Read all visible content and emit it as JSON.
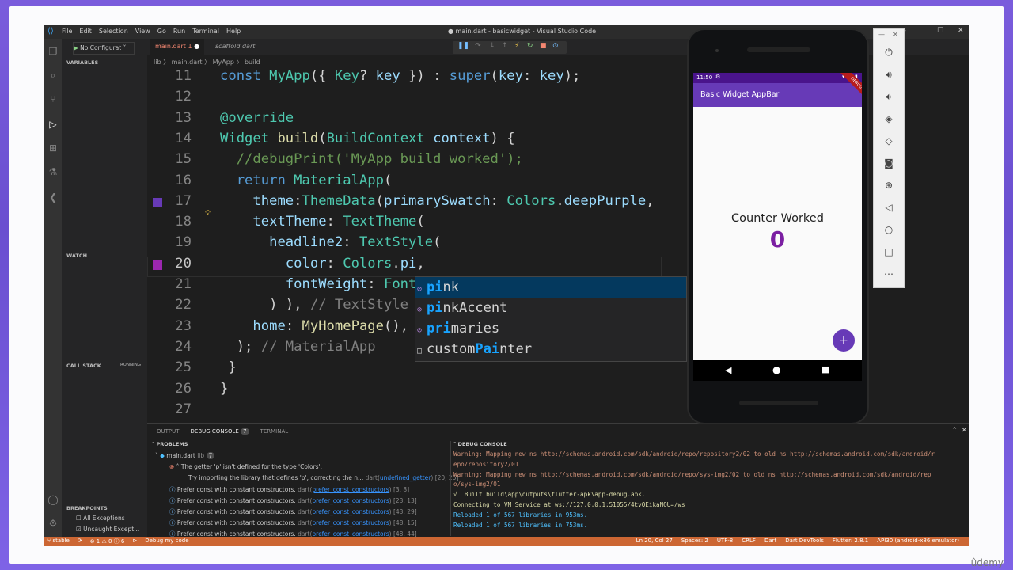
{
  "window": {
    "title": "● main.dart - basicwidget - Visual Studio Code",
    "menu": [
      "File",
      "Edit",
      "Selection",
      "View",
      "Go",
      "Run",
      "Terminal",
      "Help"
    ]
  },
  "debug": {
    "config_label": "No Configurat",
    "badge": "1"
  },
  "sidebar": {
    "variables": "VARIABLES",
    "watch": "WATCH",
    "call_stack": "CALL STACK",
    "call_stack_status": "RUNNING",
    "breakpoints": "BREAKPOINTS",
    "bp_all": "All Exceptions",
    "bp_uncaught": "Uncaught Except..."
  },
  "tabs": [
    {
      "label": "main.dart 1",
      "active": true,
      "modified": true
    },
    {
      "label": "scaffold.dart",
      "active": false
    }
  ],
  "breadcrumb": "lib 〉 main.dart 〉 MyApp 〉 build",
  "code_lines": [
    {
      "n": "11",
      "html": "<span class='kw'>const</span> <span class='ty'>MyApp</span><span class='pu'>({ </span><span class='ty'>Key</span><span class='pu'>? </span><span class='va'>key</span><span class='pu'> }) : </span><span class='kw'>super</span><span class='pu'>(</span><span class='va'>key</span><span class='pu'>: </span><span class='va'>key</span><span class='pu'>);</span>"
    },
    {
      "n": "12",
      "html": ""
    },
    {
      "n": "13",
      "html": "<span class='an'>@override</span>"
    },
    {
      "n": "14",
      "html": "<span class='ty'>Widget</span> <span class='fn'>build</span><span class='pu'>(</span><span class='ty'>BuildContext</span> <span class='va'>context</span><span class='pu'>) {</span>"
    },
    {
      "n": "15",
      "html": "  <span class='cm'>//debugPrint('MyApp build worked');</span>"
    },
    {
      "n": "16",
      "html": "  <span class='kw'>return</span> <span class='ty'>MaterialApp</span><span class='pu'>(</span>"
    },
    {
      "n": "17",
      "html": "    <span class='va'>theme</span><span class='pu'>:</span><span class='ty'>ThemeData</span><span class='pu'>(</span><span class='va'>primarySwatch</span><span class='pu'>: </span><span class='ty'>Colors</span><span class='pu'>.</span><span class='va'>deepPurple</span><span class='pu'>,</span>"
    },
    {
      "n": "18",
      "html": "    <span class='va'>textTheme</span><span class='pu'>: </span><span class='ty'>TextTheme</span><span class='pu'>(</span>"
    },
    {
      "n": "19",
      "html": "      <span class='va'>headline2</span><span class='pu'>: </span><span class='ty'>TextStyle</span><span class='pu'>(</span>"
    },
    {
      "n": "20",
      "html": "        <span class='va'>color</span><span class='pu'>: </span><span class='ty'>Colors</span><span class='pu'>.</span><span class='va'>pi</span><span class='pu'>,</span>"
    },
    {
      "n": "21",
      "html": "        <span class='va'>fontWeight</span><span class='pu'>: </span><span class='ty'>Font</span>"
    },
    {
      "n": "22",
      "html": "      <span class='pu'>) )</span><span class='pu'>, </span><span class='cm' style='color:#808080'>// TextStyle</span>"
    },
    {
      "n": "23",
      "html": "    <span class='va'>home</span><span class='pu'>: </span><span class='fn'>MyHomePage</span><span class='pu'>(), </span>"
    },
    {
      "n": "24",
      "html": "  <span class='pu'>); </span><span style='color:#808080'>// MaterialApp</span>"
    },
    {
      "n": "25",
      "html": " <span class='pu'>}</span>"
    },
    {
      "n": "26",
      "html": "<span class='pu'>}</span>"
    },
    {
      "n": "27",
      "html": ""
    }
  ],
  "suggestions": [
    {
      "label": "pink",
      "match": "pi",
      "rest": "nk"
    },
    {
      "label": "pinkAccent",
      "match": "pi",
      "rest": "nkAccent"
    },
    {
      "label": "primaries",
      "match": "pri",
      "rest": "maries"
    },
    {
      "label": "customPainter",
      "pre": "custom",
      "match": "Pai",
      "rest": "nter"
    }
  ],
  "panel": {
    "tabs": [
      "OUTPUT",
      "DEBUG CONSOLE",
      "TERMINAL"
    ],
    "debug_count": "7",
    "problems_header": "PROBLEMS",
    "problems_file": "main.dart",
    "problems_file_dir": "lib",
    "problems_count": "7",
    "debug_console_header": "DEBUG CONSOLE",
    "problems": [
      {
        "kind": "error",
        "text": "The getter 'p' isn't defined for the type 'Colors'.",
        "source": "",
        "loc": ""
      },
      {
        "kind": "hint",
        "text": "Try importing the library that defines 'p', correcting the n...",
        "source": "dart(undefined_getter)",
        "loc": "[20, 25]"
      },
      {
        "kind": "info",
        "text": "Prefer const with constant constructors.",
        "source": "dart(prefer_const_constructors)",
        "loc": "[3, 8]"
      },
      {
        "kind": "info",
        "text": "Prefer const with constant constructors.",
        "source": "dart(prefer_const_constructors)",
        "loc": "[23, 13]"
      },
      {
        "kind": "info",
        "text": "Prefer const with constant constructors.",
        "source": "dart(prefer_const_constructors)",
        "loc": "[43, 29]"
      },
      {
        "kind": "info",
        "text": "Prefer const with constant constructors.",
        "source": "dart(prefer_const_constructors)",
        "loc": "[48, 15]"
      },
      {
        "kind": "info",
        "text": "Prefer const with constant constructors.",
        "source": "dart(prefer_const_constructors)",
        "loc": "[48, 44]"
      }
    ],
    "console_lines": [
      {
        "color": "#ce9178",
        "text": "Warning: Mapping new ns http://schemas.android.com/sdk/android/repo/repository2/02 to old ns http://schemas.android.com/sdk/android/r"
      },
      {
        "color": "#ce9178",
        "text": "epo/repository2/01"
      },
      {
        "color": "#ce9178",
        "text": "Warning: Mapping new ns http://schemas.android.com/sdk/android/repo/sys-img2/02 to old ns http://schemas.android.com/sdk/android/rep"
      },
      {
        "color": "#ce9178",
        "text": "o/sys-img2/01"
      },
      {
        "color": "#dcdcaa",
        "text": "√  Built build\\app\\outputs\\flutter-apk\\app-debug.apk."
      },
      {
        "color": "#dcdcaa",
        "text": "Connecting to VM Service at ws://127.0.0.1:51055/4tvQEikaNOU=/ws"
      },
      {
        "color": "#4fc1ff",
        "text": "Reloaded 1 of 567 libraries in 953ms."
      },
      {
        "color": "#4fc1ff",
        "text": "Reloaded 1 of 567 libraries in 753ms."
      }
    ],
    "prompt": "›"
  },
  "status": {
    "branch": "stable",
    "sync": "⟳",
    "errors": "⊗ 1 ⚠ 0 ⓘ 6",
    "debug": "⊳",
    "debug_label": "Debug my code",
    "position": "Ln 20, Col 27",
    "spaces": "Spaces: 2",
    "encoding": "UTF-8",
    "eol": "CRLF",
    "lang": "Dart",
    "devtools": "Dart DevTools",
    "flutter": "Flutter: 2.8.1",
    "device": "API30 (android-x86 emulator)"
  },
  "phone": {
    "time": "11:50",
    "appbar_title": "Basic Widget AppBar",
    "counter_label": "Counter Worked",
    "counter_value": "0",
    "fab": "+",
    "debug_ribbon": "DEBUG"
  },
  "watermark": "ûdemy",
  "colors": {
    "purple": "#673ab7",
    "deep_purple_text": "#7b1fa2",
    "status_orange": "#cc6633"
  }
}
